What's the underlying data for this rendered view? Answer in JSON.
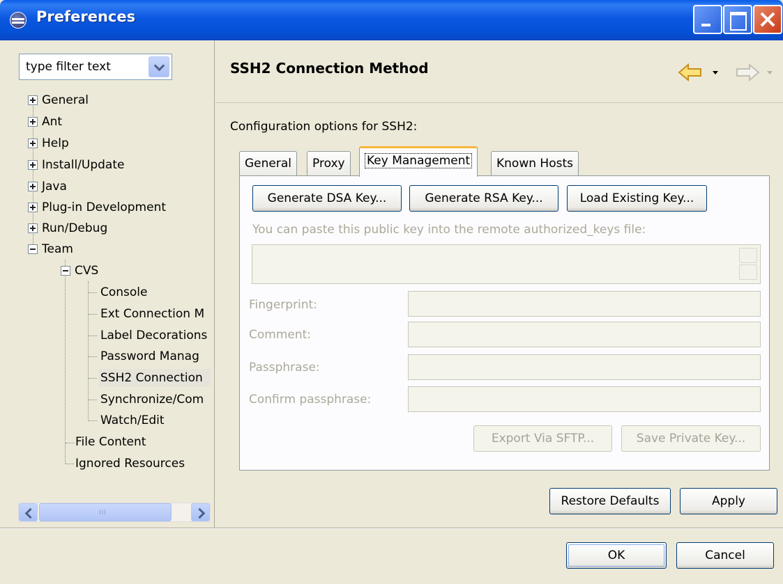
{
  "window": {
    "title": "Preferences"
  },
  "filter": {
    "value": "type filter text"
  },
  "tree": {
    "items": [
      {
        "label": "General"
      },
      {
        "label": "Ant"
      },
      {
        "label": "Help"
      },
      {
        "label": "Install/Update"
      },
      {
        "label": "Java"
      },
      {
        "label": "Plug-in Development"
      },
      {
        "label": "Run/Debug"
      },
      {
        "label": "Team"
      },
      {
        "label": "CVS"
      },
      {
        "label": "Console"
      },
      {
        "label": "Ext Connection M"
      },
      {
        "label": "Label Decorations"
      },
      {
        "label": "Password Manag"
      },
      {
        "label": "SSH2 Connection"
      },
      {
        "label": "Synchronize/Com"
      },
      {
        "label": "Watch/Edit"
      },
      {
        "label": "File Content"
      },
      {
        "label": "Ignored Resources"
      }
    ],
    "scroll_grip": "III"
  },
  "page": {
    "title": "SSH2 Connection Method",
    "config_label": "Configuration options for SSH2:"
  },
  "tabs": {
    "general": "General",
    "proxy": "Proxy",
    "key_management": "Key Management",
    "known_hosts": "Known Hosts"
  },
  "key_management": {
    "generate_dsa": "Generate DSA Key...",
    "generate_rsa": "Generate RSA Key...",
    "load_existing": "Load Existing Key...",
    "paste_hint": "You can paste this public key into the remote authorized_keys file:",
    "fingerprint_label": "Fingerprint:",
    "comment_label": "Comment:",
    "passphrase_label": "Passphrase:",
    "confirm_passphrase_label": "Confirm passphrase:",
    "export_sftp": "Export Via SFTP...",
    "save_private": "Save Private Key..."
  },
  "actions": {
    "restore_defaults": "Restore Defaults",
    "apply": "Apply",
    "ok": "OK",
    "cancel": "Cancel"
  },
  "colors": {
    "titlebar": "#0451d6",
    "dialog_bg": "#ece9d8",
    "tab_highlight": "#f7b73a",
    "disabled_text": "#aca899"
  }
}
